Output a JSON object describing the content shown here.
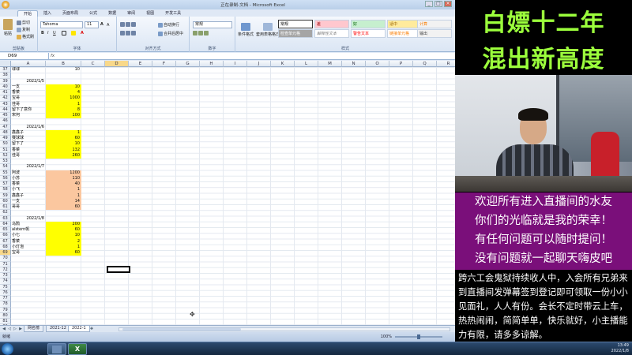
{
  "window": {
    "title": "正在录制-文档 - Microsoft Excel"
  },
  "ribbon_tabs": [
    "开始",
    "插入",
    "页面布局",
    "公式",
    "数据",
    "审阅",
    "视图",
    "开发工具"
  ],
  "ribbon": {
    "paste": "粘贴",
    "cut": "剪切",
    "copy": "复制",
    "format_painter": "格式刷",
    "font_name": "Tahoma",
    "font_size": "11",
    "wrap_text": "自动换行",
    "merge_center": "合并后居中",
    "number_format": "常规",
    "conditional_format": "条件格式",
    "table_format": "套用表格格式",
    "groups": [
      "剪贴板",
      "字体",
      "对齐方式",
      "数字",
      "样式"
    ],
    "styles": [
      "常规",
      "差",
      "好",
      "适中",
      "计算",
      "检查单元格",
      "解释性文本",
      "警告文本",
      "链接单元格",
      "输出"
    ]
  },
  "formula_bar": {
    "name_box": "D69",
    "fx": "fx"
  },
  "columns": [
    "A",
    "B",
    "C",
    "D",
    "E",
    "F",
    "G",
    "H",
    "I",
    "J",
    "K",
    "L",
    "M",
    "N",
    "O",
    "P",
    "Q",
    "R"
  ],
  "rows": [
    {
      "n": "37",
      "a": "球球",
      "b": "10",
      "fill": ""
    },
    {
      "n": "38",
      "a": "",
      "b": "",
      "fill": ""
    },
    {
      "n": "39",
      "a": "2022/1/5",
      "b": "",
      "fill": "",
      "hdr": true
    },
    {
      "n": "40",
      "a": "一支",
      "b": "10",
      "fill": "yellow"
    },
    {
      "n": "41",
      "a": "香菜",
      "b": "4",
      "fill": "yellow"
    },
    {
      "n": "42",
      "a": "宝哥",
      "b": "1000",
      "fill": "yellow"
    },
    {
      "n": "43",
      "a": "佳哥",
      "b": "1",
      "fill": "yellow"
    },
    {
      "n": "44",
      "a": "留下了意你",
      "b": "8",
      "fill": "yellow"
    },
    {
      "n": "45",
      "a": "宋何",
      "b": "100",
      "fill": "yellow"
    },
    {
      "n": "46",
      "a": "",
      "b": "",
      "fill": ""
    },
    {
      "n": "47",
      "a": "2022/1/6",
      "b": "",
      "fill": "",
      "hdr": true
    },
    {
      "n": "48",
      "a": "鑫鑫子",
      "b": "1",
      "fill": "yellow"
    },
    {
      "n": "49",
      "a": "赛球球",
      "b": "60",
      "fill": "yellow"
    },
    {
      "n": "50",
      "a": "留下了",
      "b": "10",
      "fill": "yellow"
    },
    {
      "n": "51",
      "a": "香菜",
      "b": "132",
      "fill": "yellow"
    },
    {
      "n": "52",
      "a": "佳哥",
      "b": "260",
      "fill": "yellow"
    },
    {
      "n": "53",
      "a": "",
      "b": "",
      "fill": ""
    },
    {
      "n": "54",
      "a": "2022/1/7",
      "b": "",
      "fill": "",
      "hdr": true
    },
    {
      "n": "55",
      "a": "阿波",
      "b": "1200",
      "fill": "peach"
    },
    {
      "n": "56",
      "a": "小苏",
      "b": "110",
      "fill": "peach"
    },
    {
      "n": "57",
      "a": "香菜",
      "b": "40",
      "fill": "peach"
    },
    {
      "n": "58",
      "a": "小飞",
      "b": "1",
      "fill": "peach"
    },
    {
      "n": "59",
      "a": "鑫鑫子",
      "b": "1",
      "fill": "peach"
    },
    {
      "n": "60",
      "a": "一支",
      "b": "14",
      "fill": "peach"
    },
    {
      "n": "61",
      "a": "哥哥",
      "b": "60",
      "fill": "peach"
    },
    {
      "n": "62",
      "a": "",
      "b": "",
      "fill": ""
    },
    {
      "n": "63",
      "a": "2022/1/8",
      "b": "",
      "fill": "",
      "hdr": true
    },
    {
      "n": "64",
      "a": "乌鸦",
      "b": "200",
      "fill": "yellow"
    },
    {
      "n": "65",
      "a": "alstern帆",
      "b": "60",
      "fill": "yellow"
    },
    {
      "n": "66",
      "a": "小七",
      "b": "10",
      "fill": "yellow"
    },
    {
      "n": "67",
      "a": "香菜",
      "b": "2",
      "fill": "yellow"
    },
    {
      "n": "68",
      "a": "小灯泡",
      "b": "1",
      "fill": "yellow"
    },
    {
      "n": "69",
      "a": "宝哥",
      "b": "60",
      "fill": "yellow"
    },
    {
      "n": "70",
      "a": "",
      "b": "",
      "fill": ""
    },
    {
      "n": "71",
      "a": "",
      "b": "",
      "fill": ""
    },
    {
      "n": "72",
      "a": "",
      "b": "",
      "fill": ""
    },
    {
      "n": "73",
      "a": "",
      "b": "",
      "fill": ""
    },
    {
      "n": "74",
      "a": "",
      "b": "",
      "fill": ""
    },
    {
      "n": "75",
      "a": "",
      "b": "",
      "fill": ""
    },
    {
      "n": "76",
      "a": "",
      "b": "",
      "fill": ""
    },
    {
      "n": "77",
      "a": "",
      "b": "",
      "fill": ""
    },
    {
      "n": "78",
      "a": "",
      "b": "",
      "fill": ""
    },
    {
      "n": "79",
      "a": "",
      "b": "",
      "fill": ""
    },
    {
      "n": "80",
      "a": "",
      "b": "",
      "fill": ""
    },
    {
      "n": "81",
      "a": "",
      "b": "",
      "fill": ""
    },
    {
      "n": "82",
      "a": "",
      "b": "",
      "fill": ""
    },
    {
      "n": "83",
      "a": "",
      "b": "",
      "fill": ""
    },
    {
      "n": "84",
      "a": "",
      "b": "",
      "fill": ""
    },
    {
      "n": "85",
      "a": "",
      "b": "",
      "fill": ""
    }
  ],
  "sheet_tabs": [
    "网名榜",
    "2021-12",
    "2022-1"
  ],
  "status": {
    "text": "就绪",
    "zoom": "100%"
  },
  "tray": {
    "time": "13:49",
    "date": "2022/1/8"
  },
  "overlay": {
    "title_line1": "白嫖十二年",
    "title_line2": "混出新高度",
    "welcome": [
      "欢迎所有进入直播间的水友",
      "你们的光临就是我的荣幸！",
      "有任何问题可以随时提问！",
      "没有问题就一起聊天嗨皮吧"
    ],
    "notice": "跨六工会鬼狱持续收人中，入会所有兄弟来到直播间发弹幕签到登记即可领取一份小小见面礼，人人有份。会长不定时带云上车，热热闹闹，简简单单，快乐就好，小主播能力有限，请多多谅解。"
  },
  "colors": {
    "title_green": "#9cff3c",
    "welcome_bg": "#7a0f7a",
    "yellow_fill": "#ffff00",
    "peach_fill": "#fbc79f"
  }
}
